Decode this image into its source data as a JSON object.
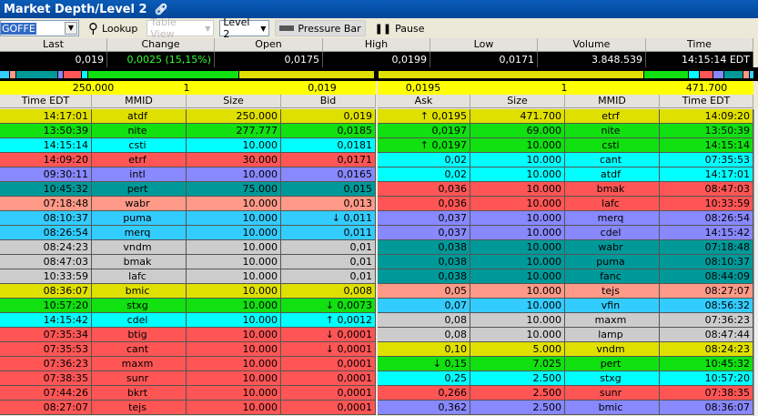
{
  "window": {
    "title": "Market Depth/Level 2",
    "link_icon": "link-icon"
  },
  "toolbar": {
    "symbol": "GOFFE",
    "lookup": "Lookup",
    "table_view": "Table View",
    "level": "Level 2",
    "pressure_bar": "Pressure Bar",
    "pause": "Pause"
  },
  "stats": {
    "headers": [
      "Last",
      "Change",
      "Open",
      "High",
      "Low",
      "Volume",
      "Time"
    ],
    "values": [
      "0,019",
      "0,0025 (15,15%)",
      "0,0175",
      "0,0199",
      "0,0171",
      "3.848.539",
      "14:15:14 EDT"
    ],
    "change_color": "#33ff33"
  },
  "summary": {
    "bid_size": "250.000",
    "bid_count": "1",
    "bid": "0,019",
    "ask": "0,0195",
    "ask_count": "1",
    "ask_size": "471.700"
  },
  "columns": {
    "bid": [
      "Time EDT",
      "MMID",
      "Size",
      "Bid"
    ],
    "ask": [
      "Ask",
      "Size",
      "MMID",
      "Time EDT"
    ]
  },
  "colors": {
    "yellow": "#e0e000",
    "green": "#11e011",
    "cyan": "#00ffff",
    "red": "#ff5555",
    "purple": "#8888ff",
    "teal": "#009999",
    "salmon": "#ff9988",
    "sky": "#33ccff",
    "gray": "#cccccc"
  },
  "bids": [
    [
      "14:17:01",
      "atdf",
      "250.000",
      "0,019",
      "yellow"
    ],
    [
      "13:50:39",
      "nite",
      "277.777",
      "0,0185",
      "green"
    ],
    [
      "14:15:14",
      "csti",
      "10.000",
      "0,0181",
      "cyan"
    ],
    [
      "14:09:20",
      "etrf",
      "30.000",
      "0,0171",
      "red"
    ],
    [
      "09:30:11",
      "intl",
      "10.000",
      "0,0165",
      "purple"
    ],
    [
      "10:45:32",
      "pert",
      "75.000",
      "0,015",
      "teal"
    ],
    [
      "07:18:48",
      "wabr",
      "10.000",
      "0,013",
      "salmon"
    ],
    [
      "08:10:37",
      "puma",
      "10.000",
      "↓ 0,011",
      "sky"
    ],
    [
      "08:26:54",
      "merq",
      "10.000",
      "0,011",
      "sky"
    ],
    [
      "08:24:23",
      "vndm",
      "10.000",
      "0,01",
      "gray"
    ],
    [
      "08:47:03",
      "bmak",
      "10.000",
      "0,01",
      "gray"
    ],
    [
      "10:33:59",
      "lafc",
      "10.000",
      "0,01",
      "gray"
    ],
    [
      "08:36:07",
      "bmic",
      "10.000",
      "0,008",
      "yellow"
    ],
    [
      "10:57:20",
      "stxg",
      "10.000",
      "↓ 0,0073",
      "green"
    ],
    [
      "14:15:42",
      "cdel",
      "10.000",
      "↑ 0,0012",
      "cyan"
    ],
    [
      "07:35:34",
      "btig",
      "10.000",
      "↓ 0,0001",
      "red"
    ],
    [
      "07:35:53",
      "cant",
      "10.000",
      "↓ 0,0001",
      "red"
    ],
    [
      "07:36:23",
      "maxm",
      "10.000",
      "0,0001",
      "red"
    ],
    [
      "07:38:35",
      "sunr",
      "10.000",
      "0,0001",
      "red"
    ],
    [
      "07:44:26",
      "bkrt",
      "10.000",
      "0,0001",
      "red"
    ],
    [
      "08:27:07",
      "tejs",
      "10.000",
      "0,0001",
      "red"
    ]
  ],
  "asks": [
    [
      "↑ 0,0195",
      "471.700",
      "etrf",
      "14:09:20",
      "yellow"
    ],
    [
      "0,0197",
      "69.000",
      "nite",
      "13:50:39",
      "green"
    ],
    [
      "↑ 0,0197",
      "10.000",
      "csti",
      "14:15:14",
      "green"
    ],
    [
      "0,02",
      "10.000",
      "cant",
      "07:35:53",
      "cyan"
    ],
    [
      "0,02",
      "10.000",
      "atdf",
      "14:17:01",
      "cyan"
    ],
    [
      "0,036",
      "10.000",
      "bmak",
      "08:47:03",
      "red"
    ],
    [
      "0,036",
      "10.000",
      "lafc",
      "10:33:59",
      "red"
    ],
    [
      "0,037",
      "10.000",
      "merq",
      "08:26:54",
      "purple"
    ],
    [
      "0,037",
      "10.000",
      "cdel",
      "14:15:42",
      "purple"
    ],
    [
      "0,038",
      "10.000",
      "wabr",
      "07:18:48",
      "teal"
    ],
    [
      "0,038",
      "10.000",
      "puma",
      "08:10:37",
      "teal"
    ],
    [
      "0,038",
      "10.000",
      "fanc",
      "08:44:09",
      "teal"
    ],
    [
      "0,05",
      "10.000",
      "tejs",
      "08:27:07",
      "salmon"
    ],
    [
      "0,07",
      "10.000",
      "vfin",
      "08:56:32",
      "sky"
    ],
    [
      "0,08",
      "10.000",
      "maxm",
      "07:36:23",
      "gray"
    ],
    [
      "0,08",
      "10.000",
      "lamp",
      "08:47:44",
      "gray"
    ],
    [
      "0,10",
      "5.000",
      "vndm",
      "08:24:23",
      "yellow"
    ],
    [
      "↓ 0,15",
      "7.025",
      "pert",
      "10:45:32",
      "green"
    ],
    [
      "0,25",
      "2.500",
      "stxg",
      "10:57:20",
      "cyan"
    ],
    [
      "0,266",
      "2.500",
      "sunr",
      "07:38:35",
      "red"
    ],
    [
      "0,362",
      "2.500",
      "bmic",
      "08:36:07",
      "purple"
    ]
  ]
}
